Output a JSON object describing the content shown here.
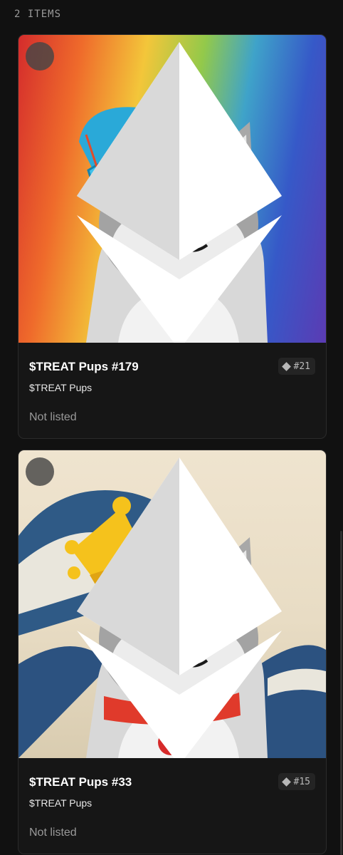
{
  "results": {
    "count_label": "2 ITEMS"
  },
  "items": [
    {
      "title": "$TREAT Pups #179",
      "collection": "$TREAT Pups",
      "rank": "#21",
      "status": "Not listed",
      "chain_icon": "ethereum-icon",
      "accessory": "blue beanie",
      "background": "rainbow crumpled paper"
    },
    {
      "title": "$TREAT Pups #33",
      "collection": "$TREAT Pups",
      "rank": "#15",
      "status": "Not listed",
      "chain_icon": "ethereum-icon",
      "accessory": "gold crown and red collar",
      "background": "great wave"
    }
  ],
  "colors": {
    "page_bg": "#111111",
    "card_bg": "#161616",
    "muted_text": "#9a9a9a"
  }
}
